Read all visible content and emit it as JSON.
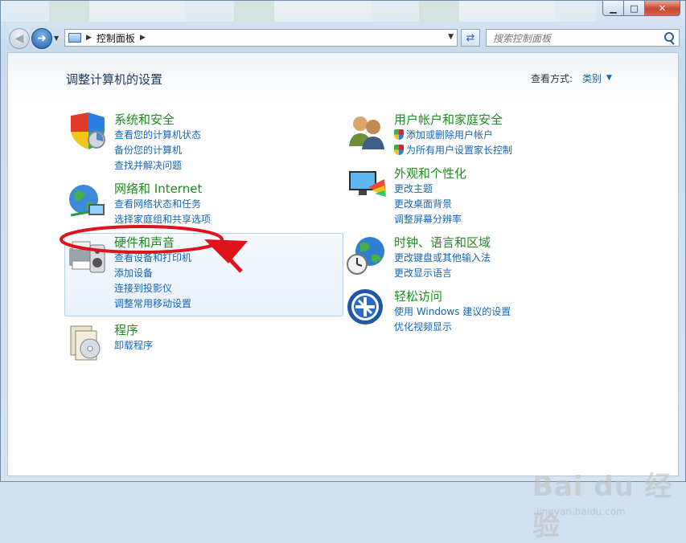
{
  "window": {
    "controls": {
      "minimize": "▁",
      "maximize": "□",
      "close": "✕"
    }
  },
  "nav": {
    "address_path": "控制面板",
    "search_placeholder": "搜索控制面板"
  },
  "content": {
    "page_title": "调整计算机的设置",
    "view_by_label": "查看方式:",
    "view_by_value": "类别"
  },
  "categories": [
    {
      "title": "系统和安全",
      "links": [
        "查看您的计算机状态",
        "备份您的计算机",
        "查找并解决问题"
      ]
    },
    {
      "title": "网络和 Internet",
      "links": [
        "查看网络状态和任务",
        "选择家庭组和共享选项"
      ]
    },
    {
      "title": "硬件和声音",
      "links": [
        "查看设备和打印机",
        "添加设备",
        "连接到投影仪",
        "调整常用移动设置"
      ]
    },
    {
      "title": "程序",
      "links": [
        "卸载程序"
      ]
    },
    {
      "title": "用户帐户和家庭安全",
      "links": [
        "添加或删除用户帐户",
        "为所有用户设置家长控制"
      ]
    },
    {
      "title": "外观和个性化",
      "links": [
        "更改主题",
        "更改桌面背景",
        "调整屏幕分辨率"
      ]
    },
    {
      "title": "时钟、语言和区域",
      "links": [
        "更改键盘或其他输入法",
        "更改显示语言"
      ]
    },
    {
      "title": "轻松访问",
      "links": [
        "使用 Windows 建议的设置",
        "优化视频显示"
      ]
    }
  ],
  "watermark": {
    "main": "Bai du 经验",
    "sub": "jingyan.baidu.com"
  },
  "colors": {
    "category_title": "#1e8c1e",
    "link": "#1466b8",
    "annotation": "#e0121b"
  }
}
